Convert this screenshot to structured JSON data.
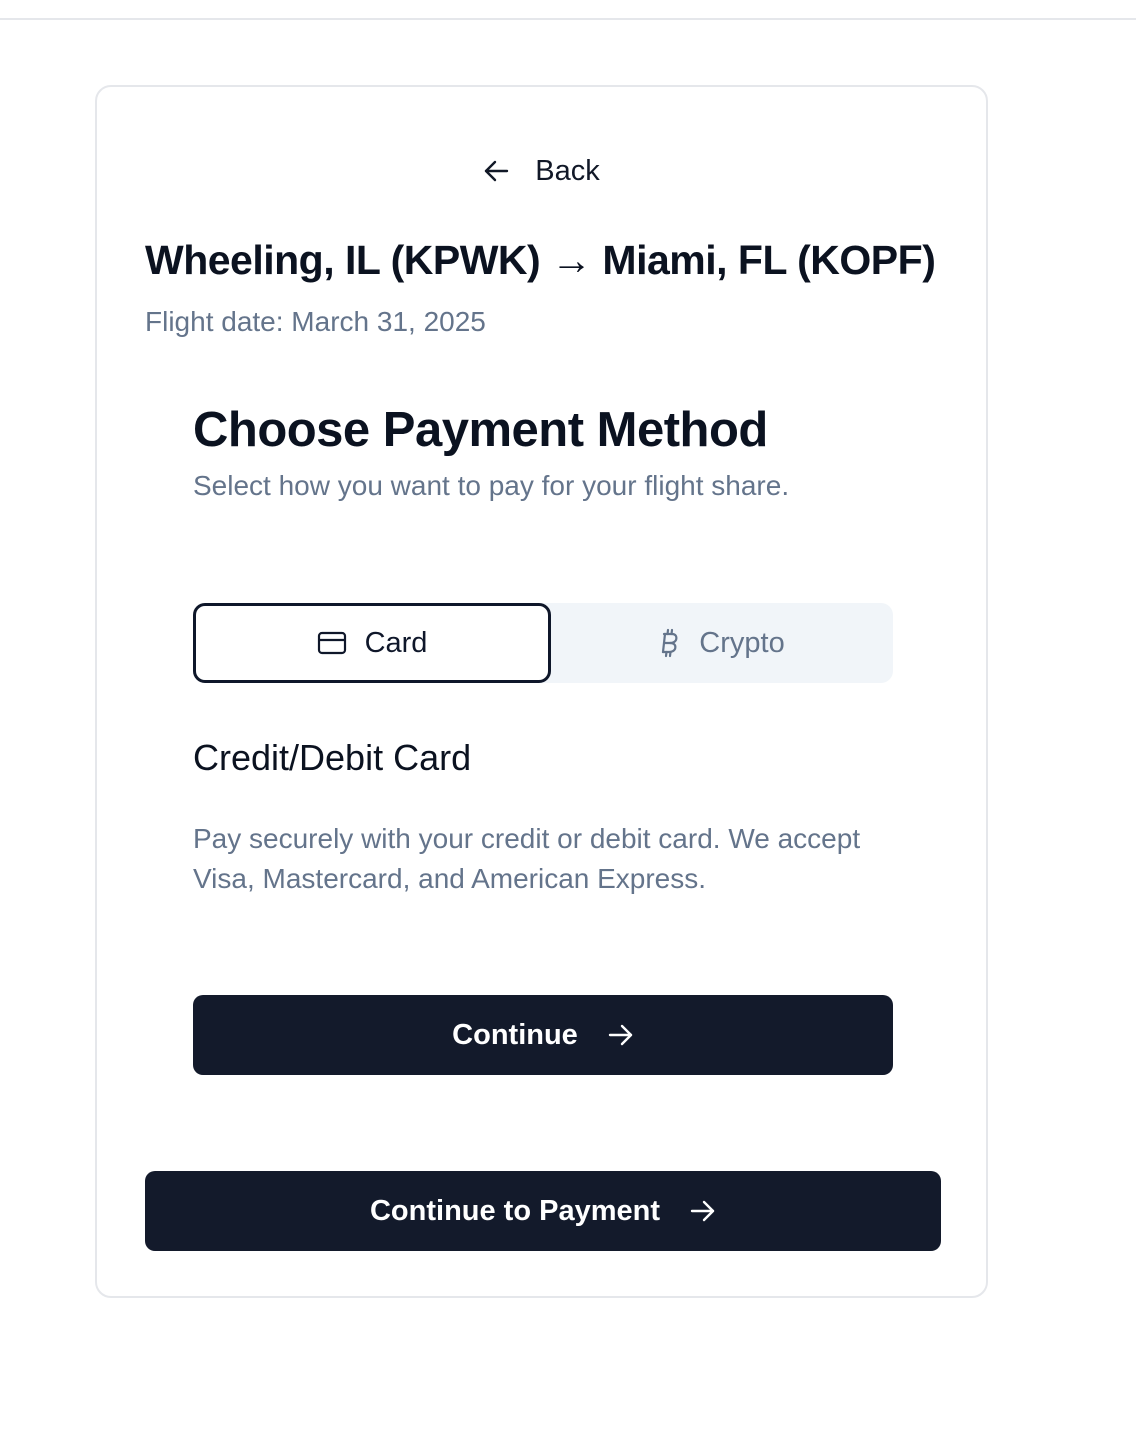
{
  "header": {
    "back_label": "Back"
  },
  "flight": {
    "route": "Wheeling, IL (KPWK) → Miami, FL (KOPF)",
    "date_label": "Flight date: March 31, 2025"
  },
  "payment": {
    "title": "Choose Payment Method",
    "subtitle": "Select how you want to pay for your flight share.",
    "tabs": [
      {
        "label": "Card",
        "icon": "credit-card-icon",
        "selected": true
      },
      {
        "label": "Crypto",
        "icon": "bitcoin-icon",
        "selected": false
      }
    ],
    "method": {
      "title": "Credit/Debit Card",
      "description": "Pay securely with your credit or debit card. We accept Visa, Mastercard, and American Express."
    },
    "continue_label": "Continue"
  },
  "footer": {
    "continue_to_payment_label": "Continue to Payment"
  },
  "colors": {
    "primary": "#131a2b",
    "muted_text": "#64748b",
    "tab_background": "#f1f5f9",
    "border": "#e5e7eb"
  }
}
